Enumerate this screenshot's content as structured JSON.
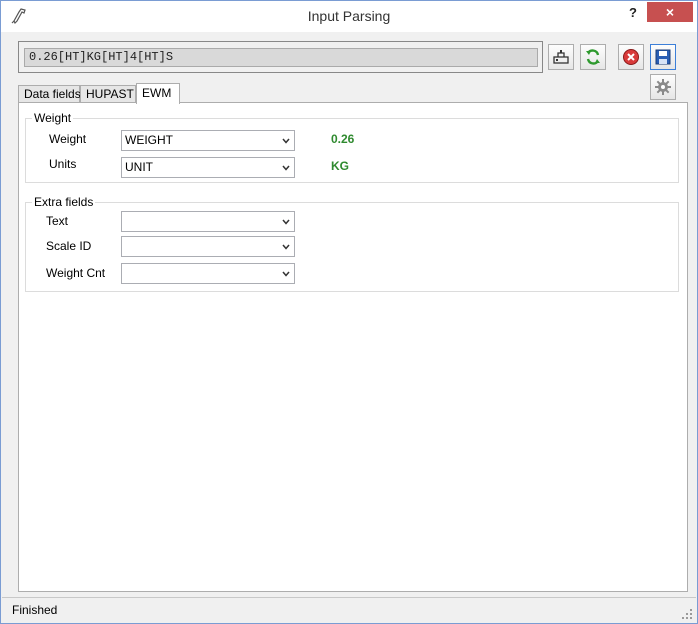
{
  "window": {
    "title": "Input Parsing",
    "help_label": "?",
    "close_label": "×"
  },
  "input": {
    "value": "0.26[HT]KG[HT]4[HT]S"
  },
  "tabs": [
    {
      "label": "Data fields",
      "active": false
    },
    {
      "label": "HUPAST",
      "active": false
    },
    {
      "label": "EWM",
      "active": true
    }
  ],
  "weight_group": {
    "title": "Weight",
    "rows": [
      {
        "label": "Weight",
        "selected": "WEIGHT",
        "value": "0.26"
      },
      {
        "label": "Units",
        "selected": "UNIT",
        "value": "KG"
      }
    ]
  },
  "extra_group": {
    "title": "Extra fields",
    "rows": [
      {
        "label": "Text",
        "selected": ""
      },
      {
        "label": "Scale ID",
        "selected": ""
      },
      {
        "label": "Weight Cnt",
        "selected": ""
      }
    ]
  },
  "status": {
    "text": "Finished"
  },
  "colors": {
    "value_green": "#2f8a2f",
    "close_red": "#c75050",
    "accent_blue": "#1f5fbf"
  }
}
